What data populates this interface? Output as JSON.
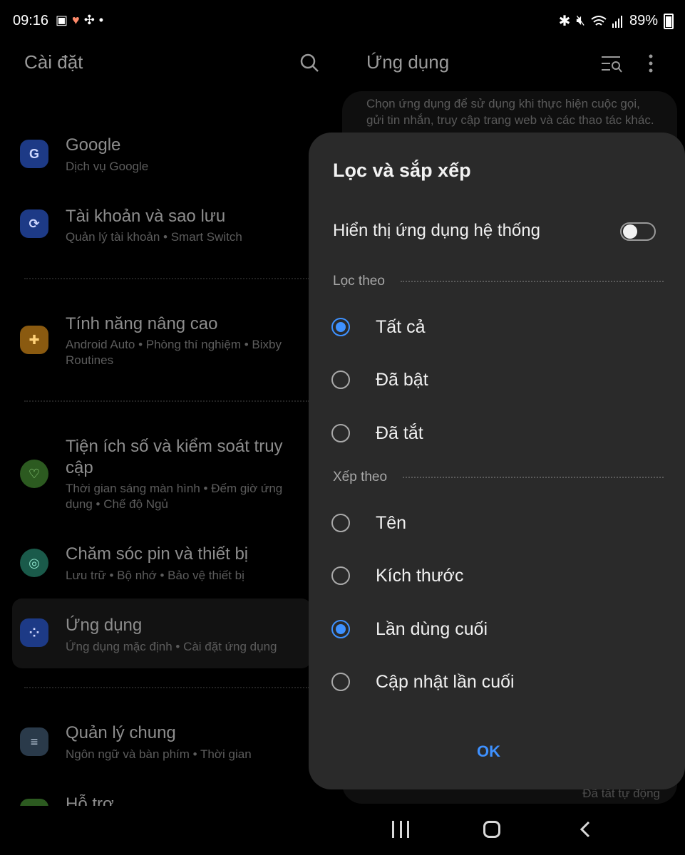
{
  "status_bar": {
    "time": "09:16",
    "battery": "89%",
    "left_icons": [
      "image-icon",
      "health-icon",
      "fan-icon",
      "dot-icon"
    ],
    "right_icons": [
      "bluetooth-icon",
      "mute-icon",
      "wifi-icon",
      "signal-icon",
      "battery-icon"
    ]
  },
  "left_pane": {
    "title": "Cài đặt",
    "items": [
      {
        "title": "Google",
        "subtitle": "Dịch vụ Google",
        "icon": "google-icon",
        "icon_color": "#1d3a86"
      },
      {
        "title": "Tài khoản và sao lưu",
        "subtitle": "Quản lý tài khoản  •  Smart Switch",
        "icon": "sync-icon",
        "icon_color": "#1d3a86"
      },
      {
        "title": "Tính năng nâng cao",
        "subtitle": "Android Auto  •  Phòng thí nghiệm  •  Bixby",
        "subtitle2": "Routines",
        "icon": "gear-plus-icon",
        "icon_color": "#8a5a10"
      },
      {
        "title": "Tiện ích số và kiểm soát truy",
        "title2": "cập",
        "subtitle": "Thời gian sáng màn hình  •  Đếm giờ ứng",
        "subtitle2": "dụng  •  Chế độ Ngủ",
        "icon": "wellbeing-icon",
        "icon_color": "#2c5a20"
      },
      {
        "title": "Chăm sóc pin và thiết bị",
        "subtitle": "Lưu trữ  •  Bộ nhớ  •  Bảo vệ thiết bị",
        "icon": "device-care-icon",
        "icon_color": "#1a5a4a"
      },
      {
        "title": "Ứng dụng",
        "subtitle": "Ứng dụng mặc định  •  Cài đặt ứng dụng",
        "icon": "apps-icon",
        "icon_color": "#1d3a86"
      },
      {
        "title": "Quản lý chung",
        "subtitle": "Ngôn ngữ và bàn phím  •  Thời gian",
        "icon": "sliders-icon",
        "icon_color": "#2a3a4a"
      },
      {
        "title": "Hỗ trợ",
        "icon": "accessibility-icon",
        "icon_color": "#2c5a20"
      }
    ]
  },
  "right_pane": {
    "title": "Ứng dụng",
    "description": "Chọn ứng dụng để sử dụng khi thực hiện cuộc gọi, gửi tin nhắn, truy cập trang web và các thao tác khác.",
    "bottom_text": "Đã tắt tự động"
  },
  "dialog": {
    "title": "Lọc và sắp xếp",
    "toggle_label": "Hiển thị ứng dụng hệ thống",
    "toggle_on": false,
    "filter_section": "Lọc theo",
    "filter_options": [
      {
        "label": "Tất cả",
        "selected": true
      },
      {
        "label": "Đã bật",
        "selected": false
      },
      {
        "label": "Đã tắt",
        "selected": false
      }
    ],
    "sort_section": "Xếp theo",
    "sort_options": [
      {
        "label": "Tên",
        "selected": false
      },
      {
        "label": "Kích thước",
        "selected": false
      },
      {
        "label": "Lần dùng cuối",
        "selected": true
      },
      {
        "label": "Cập nhật lần cuối",
        "selected": false
      }
    ],
    "ok_label": "OK"
  },
  "colors": {
    "accent": "#3e91ff",
    "dialog_bg": "#2a2a2a",
    "background": "#000000"
  }
}
